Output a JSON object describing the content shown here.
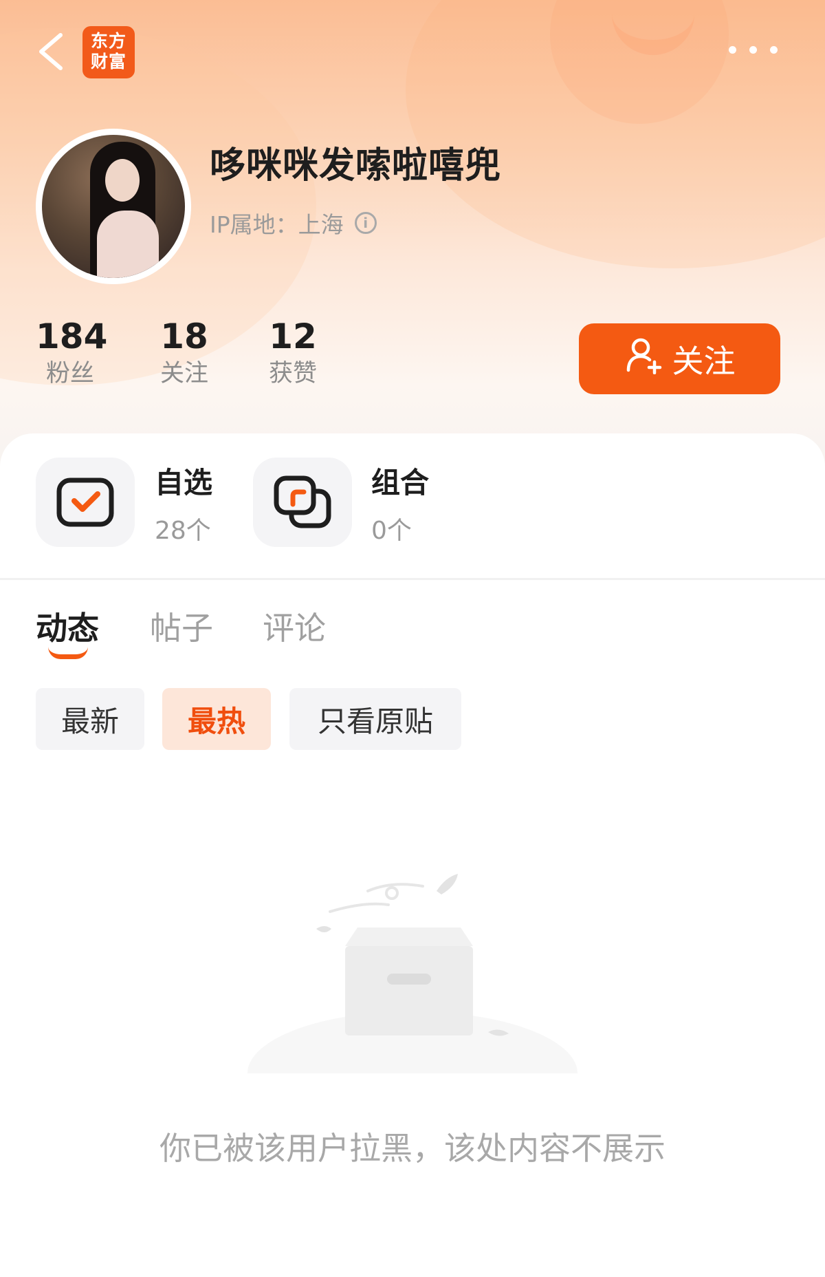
{
  "header": {
    "logo_line1": "东方",
    "logo_line2": "财富",
    "back_icon": "chevron-left-icon",
    "more_icon": "more-dots-icon"
  },
  "profile": {
    "username": "哆咪咪发嗦啦嘻兜",
    "ip_location": "IP属地：上海",
    "info_icon": "info-icon"
  },
  "stats": [
    {
      "value": "184",
      "label": "粉丝"
    },
    {
      "value": "18",
      "label": "关注"
    },
    {
      "value": "12",
      "label": "获赞"
    }
  ],
  "follow_button": {
    "label": "关注",
    "icon": "add-user-icon"
  },
  "quick_links": [
    {
      "title": "自选",
      "count": "28个",
      "icon": "checkbox-icon"
    },
    {
      "title": "组合",
      "count": "0个",
      "icon": "portfolio-icon"
    }
  ],
  "tabs": [
    {
      "label": "动态",
      "active": true
    },
    {
      "label": "帖子",
      "active": false
    },
    {
      "label": "评论",
      "active": false
    }
  ],
  "filters": [
    {
      "label": "最新",
      "active": false
    },
    {
      "label": "最热",
      "active": true
    },
    {
      "label": "只看原贴",
      "active": false
    }
  ],
  "empty_state": {
    "message": "你已被该用户拉黑，该处内容不展示",
    "illustration": "empty-box-icon"
  },
  "colors": {
    "accent": "#f45a12",
    "logo": "#f25a1a",
    "active_filter_bg": "#fde6d9"
  }
}
